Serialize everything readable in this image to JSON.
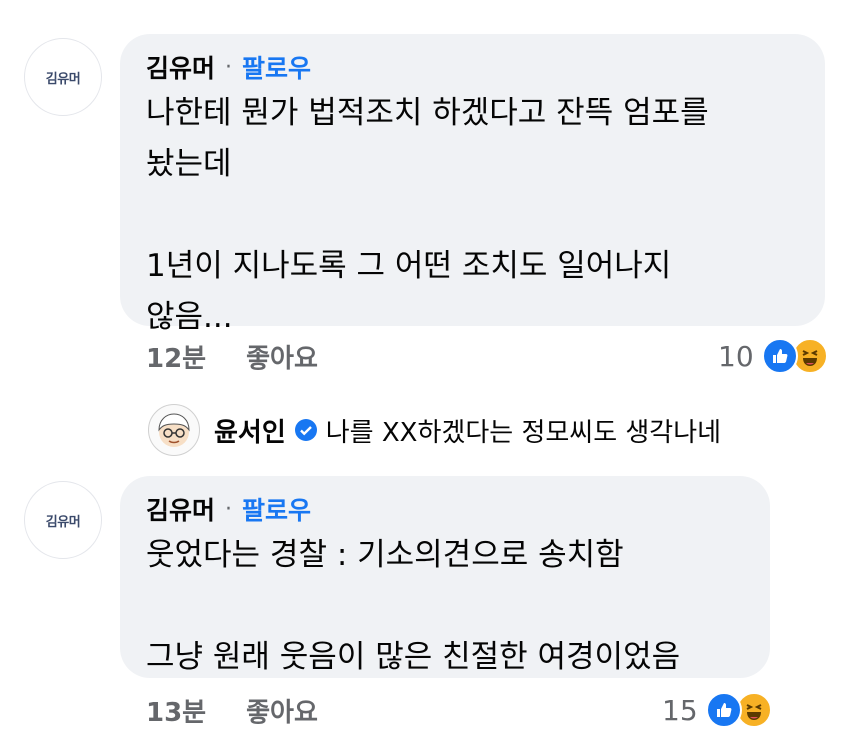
{
  "comment1": {
    "avatar_text": "김유머",
    "author": "김유머",
    "separator": "·",
    "follow_label": "팔로우",
    "text": "나한테 뭔가 법적조치 하겠다고 잔뜩 엄포를\n놨는데\n\n1년이 지나도록 그 어떤 조치도 일어나지\n않음...",
    "time": "12분",
    "like_label": "좋아요",
    "reaction_count": "10"
  },
  "reply": {
    "author": "윤서인",
    "text": "나를 XX하겠다는 정모씨도 생각나네"
  },
  "comment2": {
    "avatar_text": "김유머",
    "author": "김유머",
    "separator": "·",
    "follow_label": "팔로우",
    "text": "웃었다는 경찰 : 기소의견으로 송치함\n\n그냥 원래 웃음이 많은 친절한 여경이었음",
    "time": "13분",
    "like_label": "좋아요",
    "reaction_count": "15"
  },
  "colors": {
    "follow": "#1877f2",
    "bubble_bg": "#f0f2f5",
    "meta_gray": "#65676b",
    "like": "#1877f2",
    "haha": "#f7b125"
  },
  "icons": [
    "like-icon",
    "haha-icon",
    "verified-badge-icon"
  ]
}
